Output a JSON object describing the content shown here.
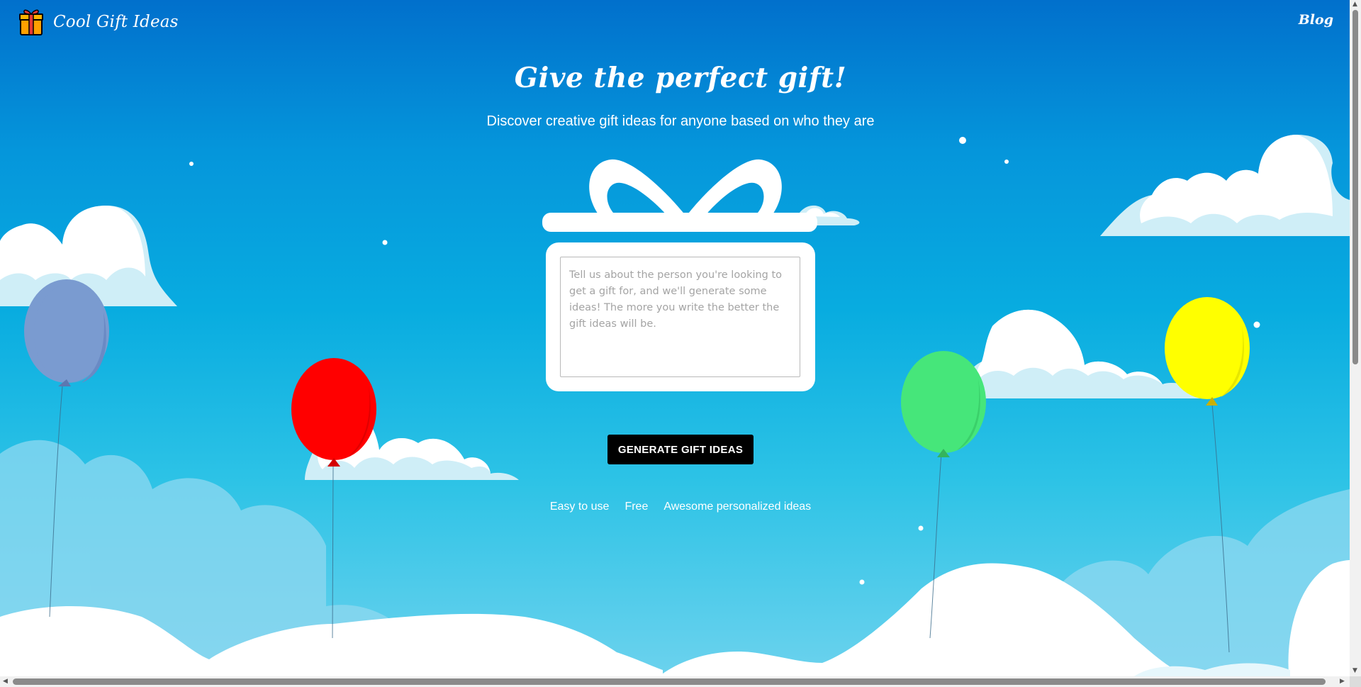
{
  "header": {
    "brand_name": "Cool Gift Ideas",
    "brand_icon": "gift-icon",
    "blog_label": "Blog"
  },
  "hero": {
    "title": "Give the perfect gift!",
    "subtitle": "Discover creative gift ideas for anyone based on who they are"
  },
  "form": {
    "description_placeholder": "Tell us about the person you're looking to get a gift for, and we'll generate some ideas! The more you write the better the gift ideas will be.",
    "description_value": "",
    "generate_label": "GENERATE GIFT IDEAS"
  },
  "features": [
    "Easy to use",
    "Free",
    "Awesome personalized ideas"
  ],
  "colors": {
    "sky_top": "#0170cc",
    "sky_bottom": "#6fd3ee",
    "balloon_blue": "#7a9bd0",
    "balloon_red": "#ff0000",
    "balloon_green": "#46e67a",
    "balloon_yellow": "#ffff00",
    "button_bg": "#000000"
  }
}
